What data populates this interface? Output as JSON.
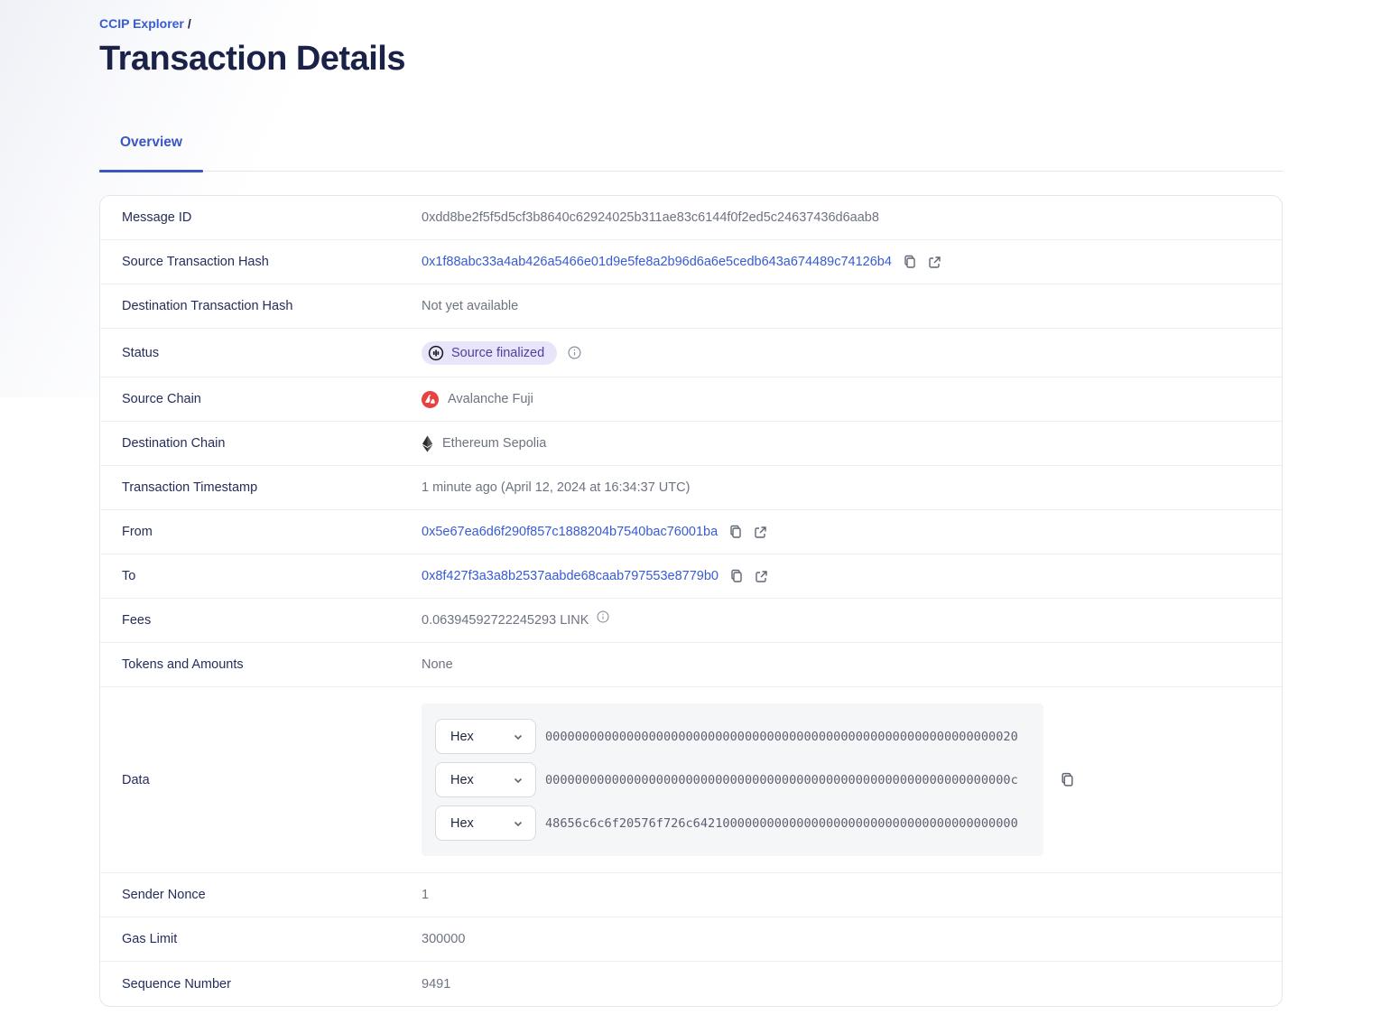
{
  "header": {
    "breadcrumb": "CCIP Explorer",
    "breadcrumb_separator": "/",
    "title": "Transaction Details",
    "tab_overview": "Overview"
  },
  "colors": {
    "accent_blue": "#375bd2",
    "title_navy": "#1a2347",
    "badge_bg": "#e9e4f9",
    "badge_text": "#4b429e",
    "avalanche_red": "#e84142"
  },
  "details": {
    "message_id": {
      "label": "Message ID",
      "value": "0xdd8be2f5f5d5cf3b8640c62924025b311ae83c6144f0f2ed5c24637436d6aab8"
    },
    "source_tx": {
      "label": "Source Transaction Hash",
      "value": "0x1f88abc33a4ab426a5466e01d9e5fe8a2b96d6a6e5cedb643a674489c74126b4"
    },
    "dest_tx": {
      "label": "Destination Transaction Hash",
      "value": "Not yet available"
    },
    "status": {
      "label": "Status",
      "value": "Source finalized"
    },
    "source_chain": {
      "label": "Source Chain",
      "value": "Avalanche Fuji"
    },
    "dest_chain": {
      "label": "Destination Chain",
      "value": "Ethereum Sepolia"
    },
    "timestamp": {
      "label": "Transaction Timestamp",
      "value": "1 minute ago (April 12, 2024 at 16:34:37 UTC)"
    },
    "from": {
      "label": "From",
      "value": "0x5e67ea6d6f290f857c1888204b7540bac76001ba"
    },
    "to": {
      "label": "To",
      "value": "0x8f427f3a3a8b2537aabde68caab797553e8779b0"
    },
    "fees": {
      "label": "Fees",
      "value": "0.06394592722245293 LINK"
    },
    "tokens": {
      "label": "Tokens and Amounts",
      "value": "None"
    },
    "data": {
      "label": "Data",
      "encoding": "Hex",
      "lines": [
        "0000000000000000000000000000000000000000000000000000000000000020",
        "000000000000000000000000000000000000000000000000000000000000000c",
        "48656c6c6f20576f726c64210000000000000000000000000000000000000000"
      ]
    },
    "sender_nonce": {
      "label": "Sender Nonce",
      "value": "1"
    },
    "gas_limit": {
      "label": "Gas Limit",
      "value": "300000"
    },
    "sequence_number": {
      "label": "Sequence Number",
      "value": "9491"
    }
  }
}
